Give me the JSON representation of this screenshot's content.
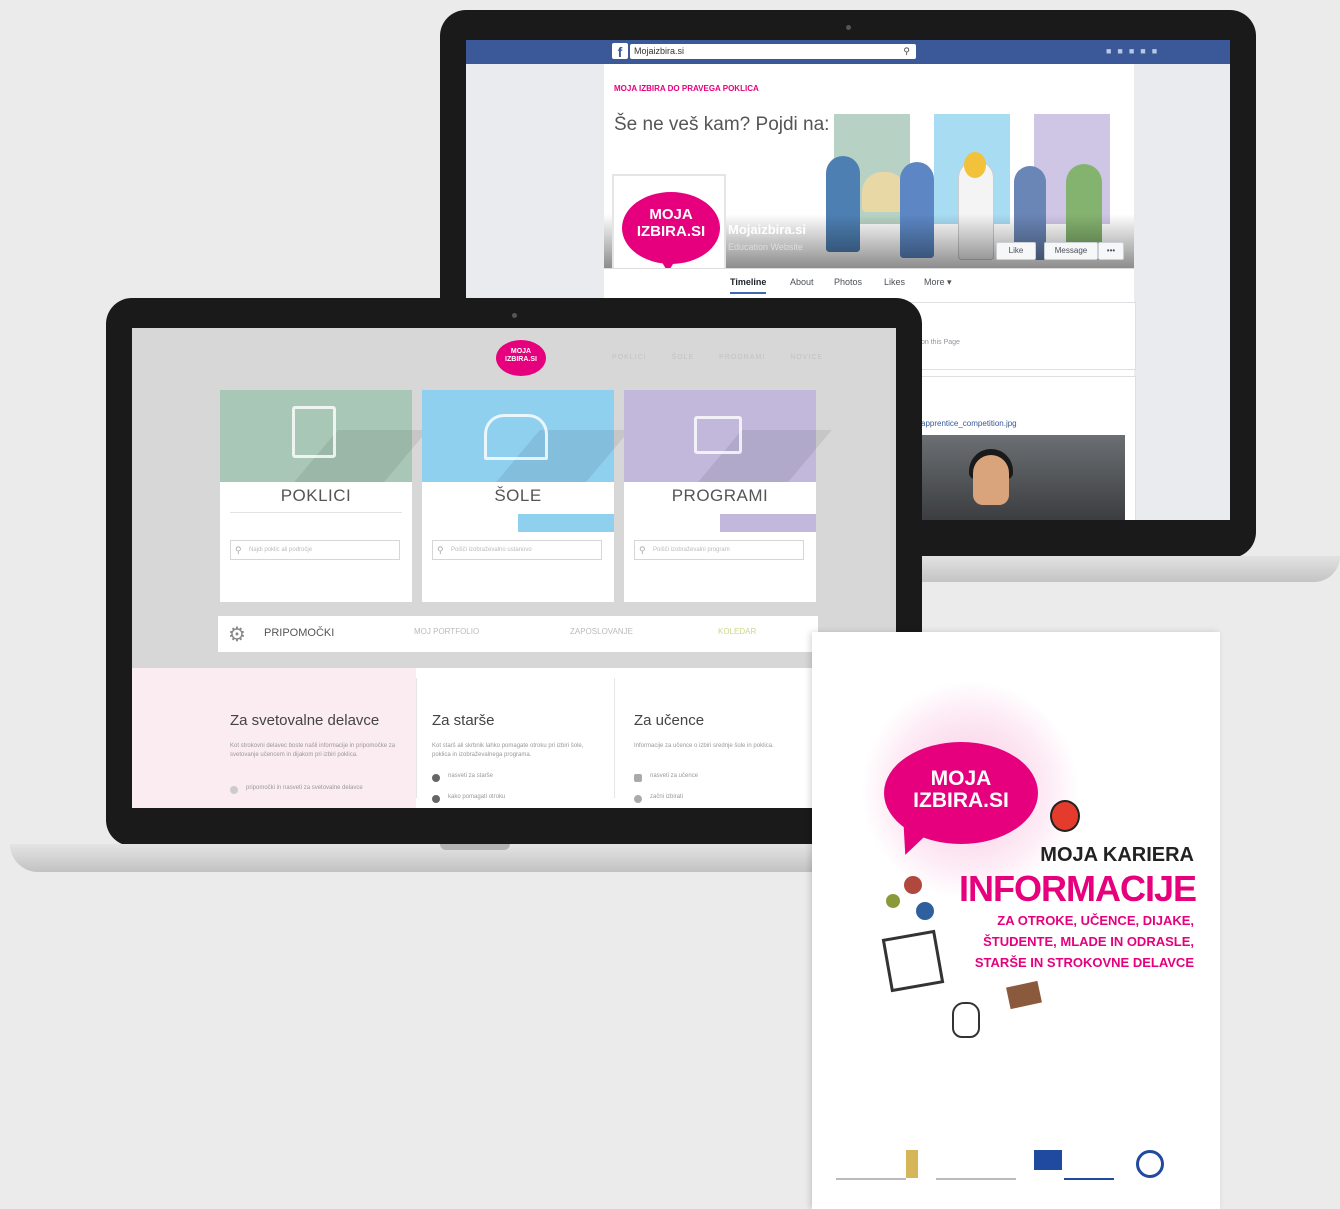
{
  "facebook": {
    "url": "Mojaizbira.si",
    "cover_tagline": "MOJA IZBIRA DO PRAVEGA POKLICA",
    "cover_heading": "Še ne veš kam? Pojdi na:",
    "page_name": "Mojaizbira.si",
    "page_category": "Education Website",
    "profile_logo": "MOJA IZBIRA.SI",
    "buttons": {
      "like": "Like",
      "message": "Message",
      "more": "•••"
    },
    "tabs": [
      "Timeline",
      "About",
      "Photos",
      "Likes",
      "More ▾"
    ],
    "post1_text": "on this Page",
    "post2_link": "apprentice_competition.jpg"
  },
  "site": {
    "logo": "MOJA IZBIRA.SI",
    "nav": "POKLICI ŠOLE PROGRAMI NOVICE",
    "cards": [
      {
        "title": "POKLICI",
        "placeholder": "Najdi poklic ali področje",
        "color": "#a9c7b7"
      },
      {
        "title": "ŠOLE",
        "placeholder": "Poišči izobraževalno ustanovo",
        "color": "#8fd0ef"
      },
      {
        "title": "PROGRAMI",
        "placeholder": "Poišči izobraževalni program",
        "color": "#c1b8dc"
      }
    ],
    "tools_label": "PRIPOMOČKI",
    "tools": [
      "MOJ PORTFOLIO",
      "ZAPOSLOVANJE",
      "KOLEDAR"
    ],
    "info": [
      {
        "heading": "Za svetovalne delavce",
        "text": "Kot strokovni delavec boste našli informacije in pripomočke za svetovanje učencem in dijakom pri izbiri poklica.",
        "items": [
          "pripomočki in nasveti za svetovalne delavce"
        ]
      },
      {
        "heading": "Za starše",
        "text": "Kot starš ali skrbnik lahko pomagate otroku pri izbiri šole, poklica in izobraževalnega programa.",
        "items": [
          "nasveti za starše",
          "kako pomagati otroku"
        ]
      },
      {
        "heading": "Za učence",
        "text": "Informacije za učence o izbiri srednje šole in poklica.",
        "items": [
          "nasveti za učence",
          "začni izbirati"
        ]
      }
    ]
  },
  "brochure": {
    "logo": "MOJA IZBIRA.SI",
    "line1": "MOJA KARIERA",
    "line2": "INFORMACIJE",
    "sub": [
      "ZA OTROKE, UČENCE, DIJAKE,",
      "ŠTUDENTE, MLADE IN ODRASLE,",
      "STARŠE IN STROKOVNE DELAVCE"
    ]
  },
  "colors": {
    "accent": "#e6007e",
    "facebook": "#3b5998"
  }
}
